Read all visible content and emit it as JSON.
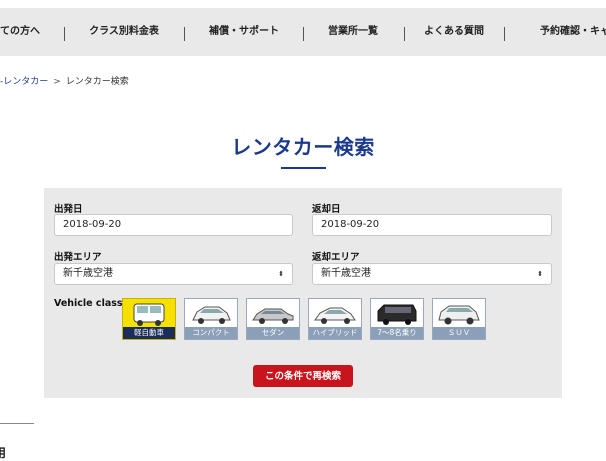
{
  "nav": {
    "items": [
      {
        "label": "ての方へ"
      },
      {
        "label": "クラス別料金表"
      },
      {
        "label": "補償・サポート"
      },
      {
        "label": "営業所一覧"
      },
      {
        "label": "よくある質問"
      },
      {
        "label": "予約確認・キャ"
      }
    ]
  },
  "breadcrumb": {
    "parent": "-レンタカー",
    "separator": ">",
    "current": "レンタカー検索"
  },
  "page": {
    "title": "レンタカー検索"
  },
  "search": {
    "departure_date_label": "出発日",
    "departure_date_value": "2018-09-20",
    "return_date_label": "返却日",
    "return_date_value": "2018-09-20",
    "departure_area_label": "出発エリア",
    "departure_area_value": "新千歳空港",
    "return_area_label": "返却エリア",
    "return_area_value": "新千歳空港",
    "vehicle_class_label": "Vehicle class",
    "vehicle_classes": [
      {
        "label": "軽自動車",
        "selected": true,
        "icon": "kei-car-icon"
      },
      {
        "label": "コンパクト",
        "selected": false,
        "icon": "compact-car-icon"
      },
      {
        "label": "セダン",
        "selected": false,
        "icon": "sedan-car-icon"
      },
      {
        "label": "ハイブリッド",
        "selected": false,
        "icon": "hybrid-car-icon"
      },
      {
        "label": "7〜8名乗り",
        "selected": false,
        "icon": "minivan-icon"
      },
      {
        "label": "ＳＵＶ",
        "selected": false,
        "icon": "suv-icon"
      }
    ],
    "submit_label": "この条件で再検索"
  },
  "bottom": {
    "heading_fragment": "用"
  },
  "colors": {
    "accent": "#1b3a8c",
    "button": "#c8141c",
    "selected_class": "#f5e000",
    "panel_bg": "#e9e9e9"
  }
}
